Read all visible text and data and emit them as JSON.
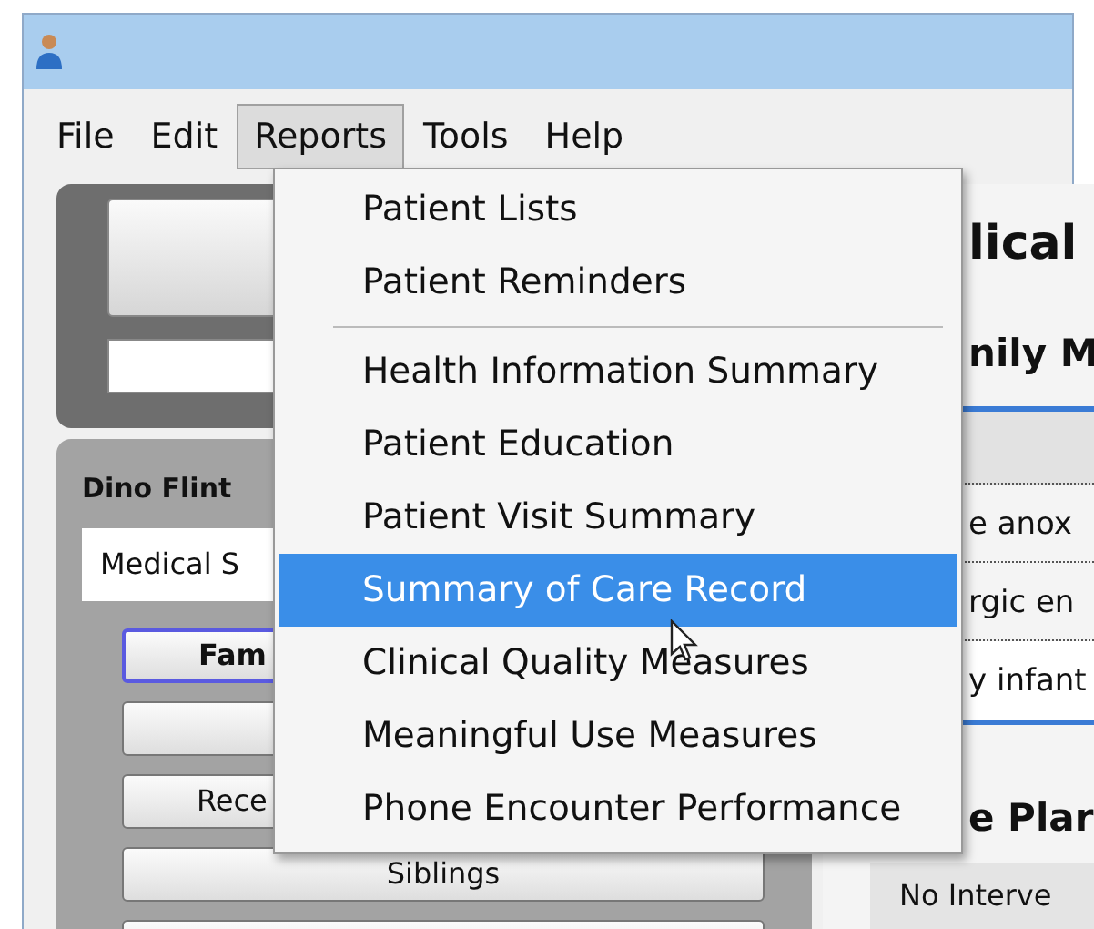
{
  "menu_bar": [
    {
      "label": "File",
      "selected": false
    },
    {
      "label": "Edit",
      "selected": false
    },
    {
      "label": "Reports",
      "selected": true
    },
    {
      "label": "Tools",
      "selected": false
    },
    {
      "label": "Help",
      "selected": false
    }
  ],
  "dropdown": [
    {
      "kind": "item",
      "label": "Patient Lists",
      "selected": false
    },
    {
      "kind": "item",
      "label": "Patient Reminders",
      "selected": false
    },
    {
      "kind": "separator"
    },
    {
      "kind": "item",
      "label": "Health Information Summary",
      "selected": false
    },
    {
      "kind": "item",
      "label": "Patient Education",
      "selected": false
    },
    {
      "kind": "item",
      "label": "Patient Visit Summary",
      "selected": false
    },
    {
      "kind": "item",
      "label": "Summary of Care Record",
      "selected": true
    },
    {
      "kind": "item",
      "label": "Clinical Quality Measures",
      "selected": false
    },
    {
      "kind": "item",
      "label": "Meaningful Use Measures",
      "selected": false
    },
    {
      "kind": "item",
      "label": "Phone Encounter Performance",
      "selected": false
    }
  ],
  "patient_panel": {
    "name": "Dino Flint",
    "selector": "Medical S",
    "buttons": [
      {
        "label": "Fam",
        "selected": true
      },
      {
        "selected": false
      },
      {
        "label": "Rece",
        "selected": false
      },
      {
        "label": "Siblings",
        "selected": false
      },
      {
        "selected": false
      }
    ]
  },
  "record_panel": {
    "heading": "lical",
    "subheading": "nily M",
    "rows": [
      {
        "text": "e anox"
      },
      {
        "text": "rgic en"
      },
      {
        "text": "y infant"
      }
    ],
    "section_heading": "e Plar",
    "section_value": "No Interve"
  }
}
